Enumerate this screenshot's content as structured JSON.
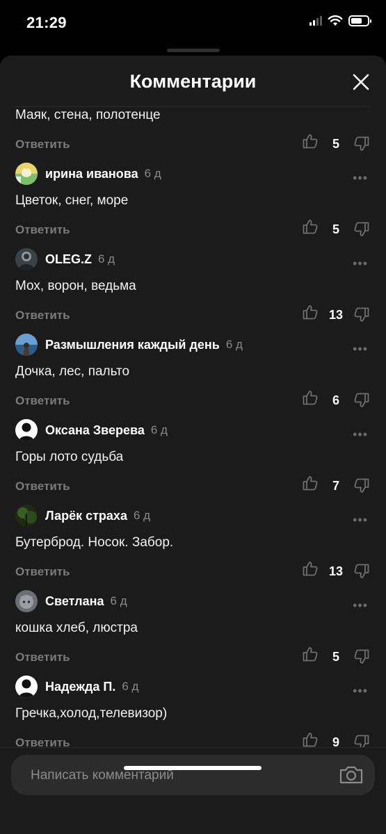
{
  "status_bar": {
    "time": "21:29"
  },
  "header": {
    "title": "Комментарии"
  },
  "reply_label": "Ответить",
  "more_label": "•••",
  "comments": [
    {
      "author": "",
      "time": "",
      "text": "Маяк, стена, полотенце",
      "likes": "5",
      "avatar": "none"
    },
    {
      "author": "ирина иванова",
      "time": "6 д",
      "text": "Цветок, снег, море",
      "likes": "5",
      "avatar": "tulip"
    },
    {
      "author": "OLEG.Z",
      "time": "6 д",
      "text": "Мох, ворон, ведьма",
      "likes": "13",
      "avatar": "dark-photo"
    },
    {
      "author": "Размышления каждый день",
      "time": "6 д",
      "text": "Дочка, лес, пальто",
      "likes": "6",
      "avatar": "sea-photo"
    },
    {
      "author": "Оксана Зверева",
      "time": "6 д",
      "text": "Горы лото судьба",
      "likes": "7",
      "avatar": "default-person"
    },
    {
      "author": "Ларёк страха",
      "time": "6 д",
      "text": "Бутерброд. Носок. Забор.",
      "likes": "13",
      "avatar": "forest-photo"
    },
    {
      "author": "Светлана",
      "time": "6 д",
      "text": "кошка  хлеб, люстра",
      "likes": "5",
      "avatar": "cat-photo"
    },
    {
      "author": "Надежда П.",
      "time": "6 д",
      "text": "Гречка,холод,телевизор)",
      "likes": "9",
      "avatar": "default-person"
    }
  ],
  "input": {
    "placeholder": "Написать комментарий"
  },
  "icons": {
    "close": "close-icon",
    "like": "thumbs-up-icon",
    "dislike": "thumbs-down-icon",
    "camera": "camera-icon",
    "more": "more-dots-icon"
  },
  "colors": {
    "background": "#000000",
    "sheet": "#1b1b1b",
    "muted_text": "#7b7b7b",
    "input_bg": "#2c2c2c"
  }
}
